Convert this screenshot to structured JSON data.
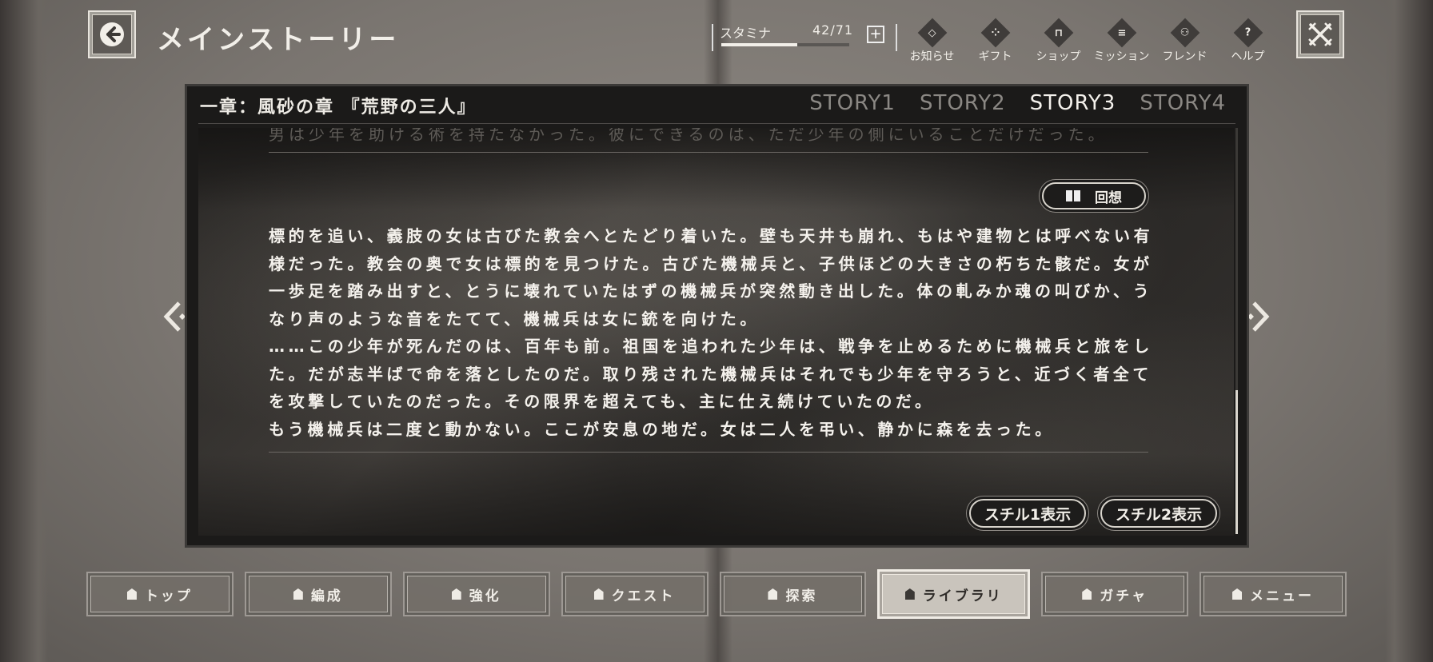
{
  "header": {
    "title": "メインストーリー",
    "stamina": {
      "label": "スタミナ",
      "value": "42/71",
      "current": 42,
      "max": 71,
      "add_label": "+"
    },
    "menu": [
      {
        "icon": "diamond-notice-icon",
        "glyph": "◇",
        "label": "お知らせ"
      },
      {
        "icon": "gift-icon",
        "glyph": "⁘",
        "label": "ギフト"
      },
      {
        "icon": "shop-icon",
        "glyph": "⊓",
        "label": "ショップ"
      },
      {
        "icon": "mission-icon",
        "glyph": "≡",
        "label": "ミッション"
      },
      {
        "icon": "friend-icon",
        "glyph": "⚇",
        "label": "フレンド"
      },
      {
        "icon": "help-icon",
        "glyph": "?",
        "label": "ヘルプ"
      }
    ]
  },
  "panel": {
    "chapter": "一章：風砂の章 『荒野の三人』",
    "tabs": [
      "STORY1",
      "STORY2",
      "STORY3",
      "STORY4"
    ],
    "active_tab": "STORY3",
    "faded_line": "男は少年を助ける術を持たなかった。彼にできるのは、ただ少年の側にいることだけだった。",
    "recall_label": "回想",
    "paragraphs": [
      "標的を追い、義肢の女は古びた教会へとたどり着いた。壁も天井も崩れ、もはや建物とは呼べない有様だった。教会の奥で女は標的を見つけた。古びた機械兵と、子供ほどの大きさの朽ちた骸だ。女が一歩足を踏み出すと、とうに壊れていたはずの機械兵が突然動き出した。体の軋みか魂の叫びか、うなり声のような音をたてて、機械兵は女に銃を向けた。",
      "……この少年が死んだのは、百年も前。祖国を追われた少年は、戦争を止めるために機械兵と旅をした。だが志半ばで命を落としたのだ。取り残された機械兵はそれでも少年を守ろうと、近づく者全てを攻撃していたのだった。その限界を超えても、主に仕え続けていたのだ。",
      "もう機械兵は二度と動かない。ここが安息の地だ。女は二人を弔い、静かに森を去った。"
    ],
    "still_buttons": [
      "スチル1表示",
      "スチル2表示"
    ]
  },
  "bottom_nav": {
    "active": "ライブラリ",
    "items": [
      {
        "icon": "top-icon",
        "label": "トップ"
      },
      {
        "icon": "party-icon",
        "label": "編成"
      },
      {
        "icon": "enhance-icon",
        "label": "強化"
      },
      {
        "icon": "quest-icon",
        "label": "クエスト"
      },
      {
        "icon": "explore-icon",
        "label": "探索"
      },
      {
        "icon": "library-icon",
        "label": "ライブラリ"
      },
      {
        "icon": "gacha-icon",
        "label": "ガチャ"
      },
      {
        "icon": "menu-icon",
        "label": "メニュー"
      }
    ]
  }
}
